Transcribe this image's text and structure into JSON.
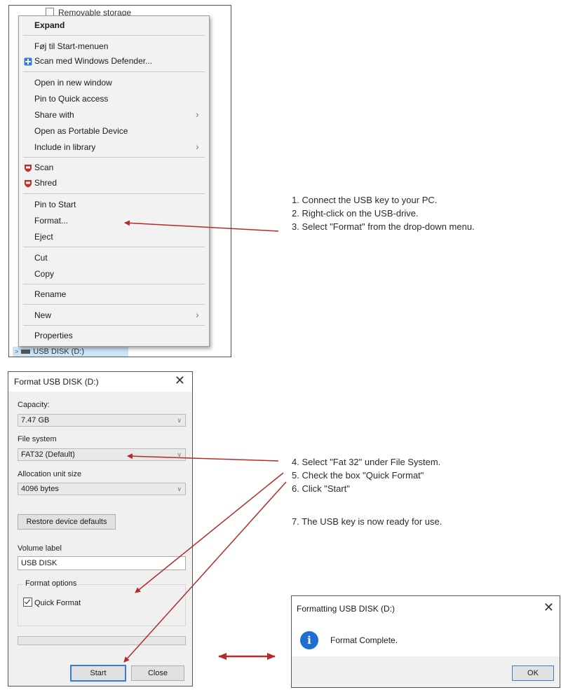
{
  "explorer": {
    "top_item_label": "Removable storage",
    "tree_item_label": "USB DISK (D:)"
  },
  "context_menu": {
    "items": [
      {
        "label": "Expand"
      },
      {
        "label": "Føj til Start-menuen"
      },
      {
        "label": "Scan med Windows Defender..."
      },
      {
        "label": "Open in new window"
      },
      {
        "label": "Pin to Quick access"
      },
      {
        "label": "Share with"
      },
      {
        "label": "Open as Portable Device"
      },
      {
        "label": "Include in library"
      },
      {
        "label": "Scan"
      },
      {
        "label": "Shred"
      },
      {
        "label": "Pin to Start"
      },
      {
        "label": "Format..."
      },
      {
        "label": "Eject"
      },
      {
        "label": "Cut"
      },
      {
        "label": "Copy"
      },
      {
        "label": "Rename"
      },
      {
        "label": "New"
      },
      {
        "label": "Properties"
      }
    ]
  },
  "instructions": {
    "step1": "1.  Connect the USB key to your PC.",
    "step2": "2.  Right-click on the USB-drive.",
    "step3": "3.  Select \"Format\" from the drop-down menu.",
    "step4": "4. Select \"Fat 32\" under File System.",
    "step5": "5. Check the box \"Quick Format\"",
    "step6": "6. Click \"Start\"",
    "step7": "7. The USB key is now ready for use."
  },
  "format_dialog": {
    "title": "Format USB DISK (D:)",
    "close_glyph": "✕",
    "capacity_label": "Capacity:",
    "capacity_value": "7.47 GB",
    "filesystem_label": "File system",
    "filesystem_value": "FAT32 (Default)",
    "alloc_label": "Allocation unit size",
    "alloc_value": "4096 bytes",
    "restore_button": "Restore device defaults",
    "volume_label_label": "Volume label",
    "volume_label_value": "USB DISK",
    "format_options_label": "Format options",
    "quick_format_label": "Quick Format",
    "quick_format_checked": true,
    "progress": 0,
    "start_button": "Start",
    "close_button": "Close"
  },
  "complete_dialog": {
    "title": "Formatting USB DISK (D:)",
    "close_glyph": "✕",
    "message": "Format Complete.",
    "ok_button": "OK",
    "icon": "info-icon"
  },
  "colors": {
    "arrow": "#b52a2a",
    "info_icon": "#1e6fd0",
    "highlight": "#cce4f7"
  }
}
